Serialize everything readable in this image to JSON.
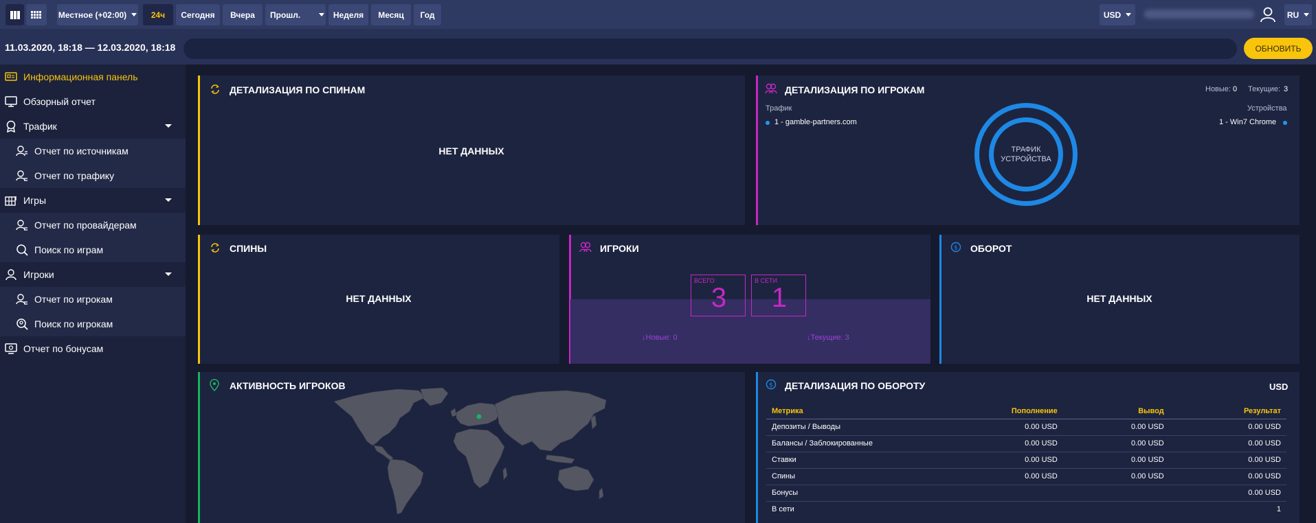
{
  "topbar": {
    "timezone": "Местное (+02:00)",
    "periods": [
      "24ч",
      "Сегодня",
      "Вчера",
      "Прошл.",
      "Неделя",
      "Месяц",
      "Год"
    ],
    "active_period": "24ч",
    "currency": "USD",
    "language": "RU"
  },
  "subbar": {
    "date_range": "11.03.2020, 18:18 — 12.03.2020, 18:18",
    "refresh_label": "ОБНОВИТЬ"
  },
  "sidebar": {
    "items": [
      {
        "label": "Информационная панель"
      },
      {
        "label": "Обзорный отчет"
      },
      {
        "label": "Трафик"
      },
      {
        "label": "Отчет по источникам"
      },
      {
        "label": "Отчет по трафику"
      },
      {
        "label": "Игры"
      },
      {
        "label": "Отчет по провайдерам"
      },
      {
        "label": "Поиск по играм"
      },
      {
        "label": "Игроки"
      },
      {
        "label": "Отчет по игрокам"
      },
      {
        "label": "Поиск по игрокам"
      },
      {
        "label": "Отчет по бонусам"
      }
    ]
  },
  "no_data": "НЕТ ДАННЫХ",
  "spin_detail": {
    "title": "ДЕТАЛИЗАЦИЯ ПО СПИНАМ"
  },
  "player_detail": {
    "title": "ДЕТАЛИЗАЦИЯ ПО ИГРОКАМ",
    "new_label": "Новые:",
    "new_value": "0",
    "current_label": "Текущие:",
    "current_value": "3",
    "traffic_label": "Трафик",
    "traffic_item": "1 - gamble-partners.com",
    "devices_label": "Устройства",
    "device_item": "1 - Win7 Chrome",
    "ring_line1": "ТРАФИК",
    "ring_line2": "УСТРОЙСТВА"
  },
  "spins": {
    "title": "СПИНЫ"
  },
  "players": {
    "title": "ИГРОКИ",
    "total_label": "ВСЕГО",
    "total_value": "3",
    "online_label": "В СЕТИ",
    "online_value": "1",
    "new_foot": "Новые: 0",
    "current_foot": "Текущие: 3"
  },
  "turnover": {
    "title": "ОБОРОТ"
  },
  "activity": {
    "title": "АКТИВНОСТЬ ИГРОКОВ"
  },
  "turnover_detail": {
    "title": "ДЕТАЛИЗАЦИЯ ПО ОБОРОТУ",
    "currency": "USD",
    "columns": [
      "Метрика",
      "Пополнение",
      "Вывод",
      "Результат"
    ],
    "rows": [
      [
        "Депозиты / Выводы",
        "0.00 USD",
        "0.00 USD",
        "0.00 USD"
      ],
      [
        "Балансы / Заблокированные",
        "0.00 USD",
        "0.00 USD",
        "0.00 USD"
      ],
      [
        "Ставки",
        "0.00 USD",
        "0.00 USD",
        "0.00 USD"
      ],
      [
        "Спины",
        "0.00 USD",
        "0.00 USD",
        "0.00 USD"
      ],
      [
        "Бонусы",
        "",
        "",
        "0.00 USD"
      ],
      [
        "В сети",
        "",
        "",
        "1"
      ]
    ]
  },
  "colors": {
    "accent_yellow": "#f8c40c",
    "accent_magenta": "#c628c4",
    "accent_blue": "#1e88e5",
    "accent_green": "#19b35a"
  }
}
